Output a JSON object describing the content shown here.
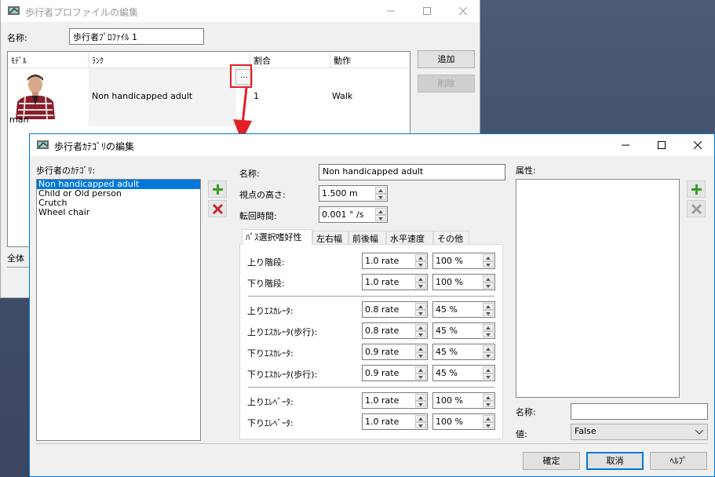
{
  "back_window": {
    "title": "歩行者プロファイルの編集",
    "name_label": "名称:",
    "name_value": "歩行者ﾌﾟﾛﾌｧｲﾙ 1",
    "columns": [
      "ﾓﾃﾞﾙ",
      "ﾗﾝｸ",
      "割合",
      "動作"
    ],
    "row": {
      "model": "man",
      "rank": "Non handicapped adult",
      "ratio": "1",
      "action": "Walk",
      "dots": "..."
    },
    "add_button": "追加",
    "delete_button": "削除",
    "bottom_label": "全体"
  },
  "dialog": {
    "title": "歩行者ｶﾃｺﾞﾘの編集",
    "category_label": "歩行者のｶﾃｺﾞﾘ:",
    "categories": [
      "Non handicapped adult",
      "Child or Old person",
      "Crutch",
      "Wheel chair"
    ],
    "name_label": "名称:",
    "name_value": "Non handicapped adult",
    "eye_height_label": "視点の高さ:",
    "eye_height_value": "1.500 m",
    "turn_time_label": "転回時間:",
    "turn_time_value": "0.001 ° /s",
    "tabs": [
      "ﾊﾟｽ選択嗜好性",
      "左右幅",
      "前後幅",
      "水平速度",
      "その他"
    ],
    "preferences": [
      {
        "label": "上り階段:",
        "rate": "1.0 rate",
        "pct": "100 %"
      },
      {
        "label": "下り階段:",
        "rate": "1.0 rate",
        "pct": "100 %"
      },
      {
        "label": "上りｴｽｶﾚｰﾀ:",
        "rate": "0.8 rate",
        "pct": "45 %"
      },
      {
        "label": "上りｴｽｶﾚｰﾀ(歩行):",
        "rate": "0.8 rate",
        "pct": "45 %"
      },
      {
        "label": "下りｴｽｶﾚｰﾀ:",
        "rate": "0.9 rate",
        "pct": "45 %"
      },
      {
        "label": "下りｴｽｶﾚｰﾀ(歩行):",
        "rate": "0.9 rate",
        "pct": "45 %"
      },
      {
        "label": "上りｴﾚﾍﾞｰﾀ:",
        "rate": "1.0 rate",
        "pct": "100 %"
      },
      {
        "label": "下りｴﾚﾍﾞｰﾀ:",
        "rate": "1.0 rate",
        "pct": "100 %"
      }
    ],
    "attributes_label": "属性:",
    "attr_name_label": "名称:",
    "attr_name_value": "",
    "attr_value_label": "値:",
    "attr_value_selected": "False",
    "ok_button": "確定",
    "cancel_button": "取消",
    "help_button": "ﾍﾙﾌﾟ"
  },
  "colors": {
    "accent": "#0078d7",
    "highlight": "#e41e26",
    "add_icon": "#3a9d23",
    "remove_icon": "#c8232b"
  }
}
